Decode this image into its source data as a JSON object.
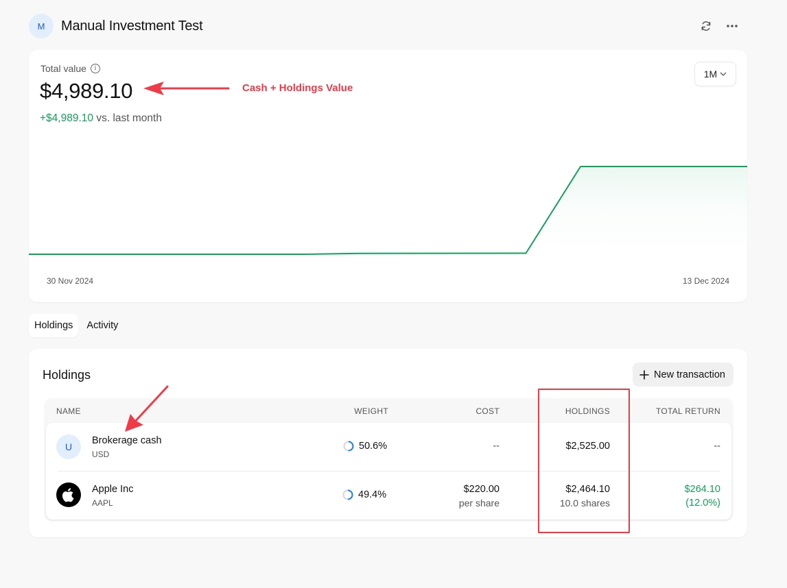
{
  "header": {
    "avatar_letter": "M",
    "title": "Manual Investment Test",
    "refresh_icon": "refresh-icon",
    "more_icon": "more-horizontal-icon"
  },
  "summary": {
    "label": "Total value",
    "info_icon": "info-icon",
    "value": "$4,989.10",
    "change_amount": "+$4,989.10",
    "change_suffix": "vs. last month",
    "period": "1M",
    "start_date": "30 Nov 2024",
    "end_date": "13 Dec 2024"
  },
  "chart_data": {
    "type": "area",
    "title": "Total value",
    "x": [
      "30 Nov 2024",
      "5 Dec 2024",
      "6 Dec 2024",
      "9 Dec 2024",
      "10 Dec 2024",
      "13 Dec 2024"
    ],
    "values": [
      0,
      0,
      50,
      60,
      4989.1,
      4989.1
    ],
    "xlabel": "",
    "ylabel": "",
    "tick_labels_x": [
      "30 Nov 2024",
      "13 Dec 2024"
    ],
    "color": "#12a15a",
    "grid": false,
    "legend": "none"
  },
  "annotations": {
    "value_note": "Cash + Holdings Value",
    "color": "#f03a47"
  },
  "tabs": [
    {
      "label": "Holdings",
      "active": true
    },
    {
      "label": "Activity",
      "active": false
    }
  ],
  "holdings": {
    "title": "Holdings",
    "new_transaction_label": "New transaction",
    "columns": [
      "NAME",
      "WEIGHT",
      "COST",
      "HOLDINGS",
      "TOTAL RETURN"
    ],
    "rows": [
      {
        "avatar": "U",
        "name": "Brokerage cash",
        "symbol": "USD",
        "weight": "50.6%",
        "weight_fraction": 0.506,
        "cost": "--",
        "cost_sub": "",
        "holdings": "$2,525.00",
        "holdings_sub": "",
        "total_return": "--",
        "total_return_pct": ""
      },
      {
        "avatar": "apple-logo-icon",
        "name": "Apple Inc",
        "symbol": "AAPL",
        "weight": "49.4%",
        "weight_fraction": 0.494,
        "cost": "$220.00",
        "cost_sub": "per share",
        "holdings": "$2,464.10",
        "holdings_sub": "10.0 shares",
        "total_return": "$264.10",
        "total_return_pct": "(12.0%)"
      }
    ]
  },
  "colors": {
    "positive": "#12a15a",
    "accent": "#1c5fd4",
    "weight_ring": "#1a7fe8",
    "annotation": "#f03a47"
  }
}
